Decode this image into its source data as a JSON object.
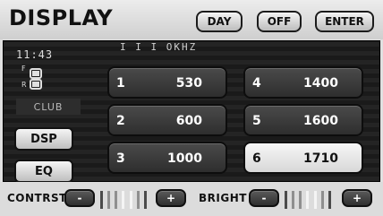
{
  "header": {
    "title": "DISPLAY",
    "buttons": {
      "day": "DAY",
      "off": "OFF",
      "enter": "ENTER"
    }
  },
  "status": {
    "clock": "11:43",
    "frequency_fragment": "I I I OKHZ",
    "seat_labels": {
      "front": "F",
      "rear": "R"
    },
    "mode": "CLUB"
  },
  "side_buttons": {
    "dsp": "DSP",
    "eq": "EQ"
  },
  "presets": [
    {
      "num": "1",
      "value": "530",
      "active": false
    },
    {
      "num": "2",
      "value": "600",
      "active": false
    },
    {
      "num": "3",
      "value": "1000",
      "active": false
    },
    {
      "num": "4",
      "value": "1400",
      "active": false
    },
    {
      "num": "5",
      "value": "1600",
      "active": false
    },
    {
      "num": "6",
      "value": "1710",
      "active": true
    }
  ],
  "bottom": {
    "contrast": {
      "label": "CONTRST",
      "minus": "-",
      "plus": "+"
    },
    "bright": {
      "label": "BRIGHT",
      "minus": "-",
      "plus": "+"
    }
  }
}
